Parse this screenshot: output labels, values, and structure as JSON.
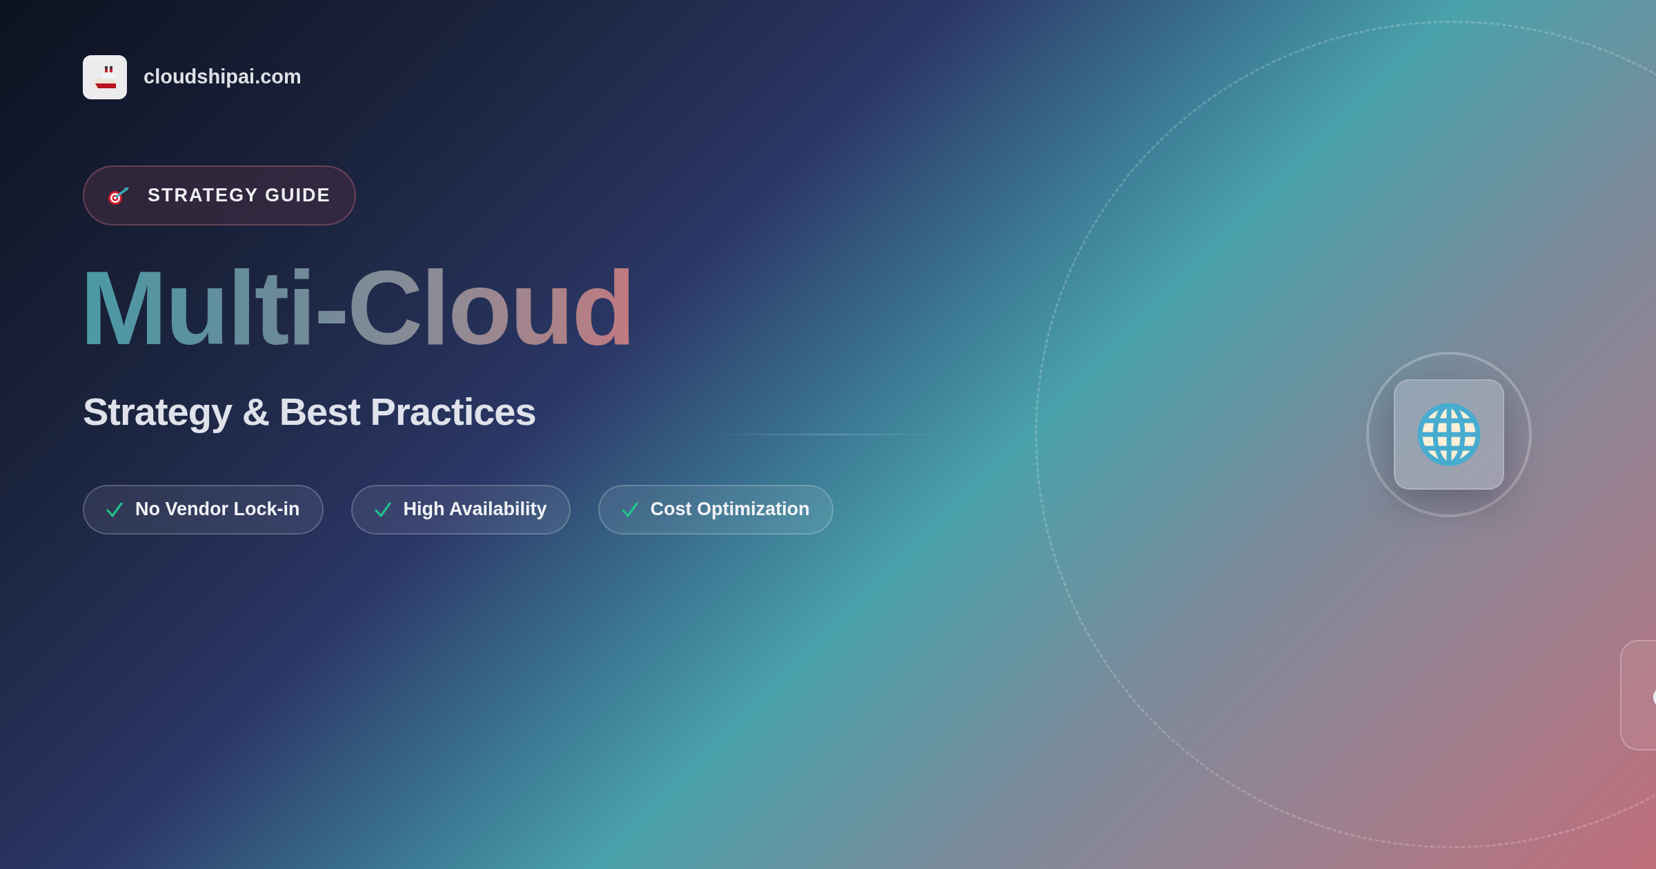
{
  "site": {
    "name": "cloudshipai.com"
  },
  "badge": {
    "label": "STRATEGY GUIDE"
  },
  "title": "Multi-Cloud",
  "subtitle": "Strategy & Best Practices",
  "features": [
    {
      "label": "No Vendor Lock-in"
    },
    {
      "label": "High Availability"
    },
    {
      "label": "Cost Optimization"
    }
  ]
}
